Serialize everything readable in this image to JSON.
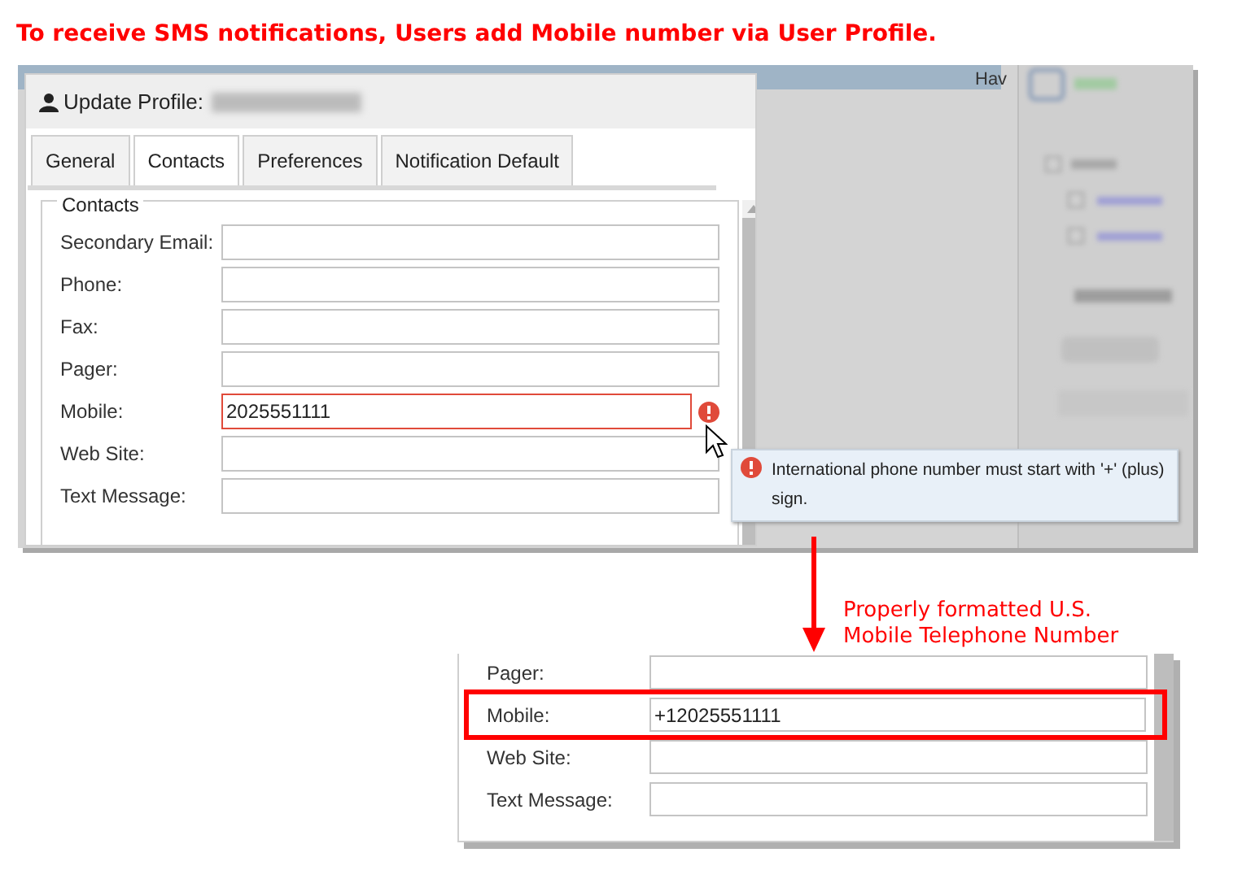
{
  "heading": "To receive SMS notifications, Users add Mobile number via User Profile.",
  "background_app": {
    "column_header": "Hav"
  },
  "dialog": {
    "title": "Update Profile:",
    "tabs": [
      {
        "label": "General",
        "selected": false
      },
      {
        "label": "Contacts",
        "selected": true
      },
      {
        "label": "Preferences",
        "selected": false
      },
      {
        "label": "Notification Default",
        "selected": false
      }
    ],
    "section_title": "Contacts",
    "fields": [
      {
        "label": "Secondary Email:",
        "error": false
      },
      {
        "label": "Phone:",
        "error": false
      },
      {
        "label": "Fax:",
        "error": false
      },
      {
        "label": "Pager:",
        "error": false
      },
      {
        "label": "Mobile:",
        "value": "2025551111",
        "error": true
      },
      {
        "label": "Web Site:",
        "error": false
      },
      {
        "label": "Text Message:",
        "error": false
      }
    ],
    "error_tooltip": "International phone number must start with '+' (plus) sign."
  },
  "annotation": [
    "Properly formatted U.S.",
    "Mobile Telephone Number"
  ],
  "corrected_view": {
    "fields": [
      {
        "label": "Pager:",
        "highlighted": false
      },
      {
        "label": "Mobile:",
        "value": "+12025551111",
        "highlighted": true
      },
      {
        "label": "Web Site:",
        "highlighted": false
      },
      {
        "label": "Text Message:",
        "highlighted": false
      }
    ]
  }
}
